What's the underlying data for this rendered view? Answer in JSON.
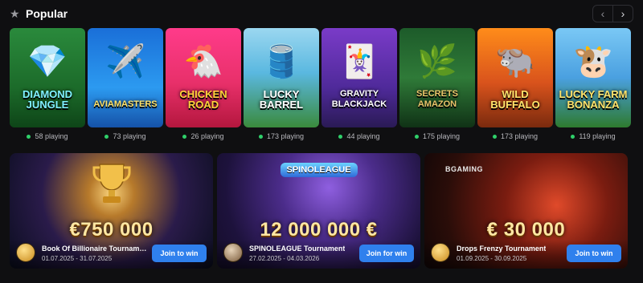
{
  "section": {
    "title": "Popular",
    "star_icon": "star-icon",
    "prev_icon": "chevron-left-icon",
    "next_icon": "chevron-right-icon"
  },
  "games": [
    {
      "title": "Diamond Jungle",
      "playing": "58 playing"
    },
    {
      "title": "Aviamasters",
      "playing": "73 playing"
    },
    {
      "title": "Chicken Road",
      "playing": "26 playing"
    },
    {
      "title": "Lucky Barrel",
      "playing": "173 playing"
    },
    {
      "title": "Gravity Blackjack",
      "playing": "44 playing"
    },
    {
      "title": "Secrets Amazon",
      "playing": "175 playing"
    },
    {
      "title": "Wild Buffalo",
      "playing": "173 playing"
    },
    {
      "title": "Lucky Farm Bonanza",
      "playing": "119 playing"
    }
  ],
  "tournaments": [
    {
      "prize": "€750 000",
      "name": "Book Of Billionaire Tournam…",
      "dates": "01.07.2025 - 31.07.2025",
      "button": "Join to win"
    },
    {
      "prize": "12 000 000 €",
      "name": "SPINOLEAGUE Tournament",
      "dates": "27.02.2025 - 04.03.2026",
      "button": "Join for win",
      "logo": "SPINOLEAGUE"
    },
    {
      "prize": "€ 30 000",
      "name": "Drops Frenzy Tournament",
      "dates": "01.09.2025 - 30.09.2025",
      "button": "Join to win",
      "brand": "BGAMING"
    }
  ]
}
